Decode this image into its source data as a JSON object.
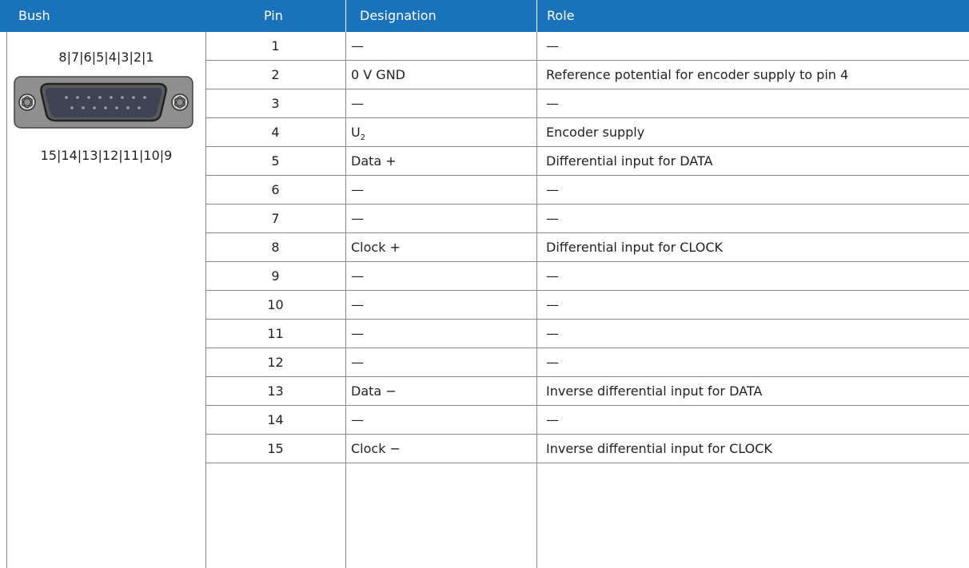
{
  "headers": {
    "bush": "Bush",
    "pin": "Pin",
    "designation": "Designation",
    "role": "Role"
  },
  "bush": {
    "top_pins": "8|7|6|5|4|3|2|1",
    "bottom_pins": "15|14|13|12|11|10|9",
    "connector_icon": "d-sub-15-pin-connector-icon"
  },
  "rows": [
    {
      "pin": "1",
      "designation": "—",
      "role": "—"
    },
    {
      "pin": "2",
      "designation": "0 V GND",
      "role": "Reference potential for encoder supply to pin 4"
    },
    {
      "pin": "3",
      "designation": "—",
      "role": "—"
    },
    {
      "pin": "4",
      "designation": "U",
      "designation_sub": "2",
      "role": "Encoder supply"
    },
    {
      "pin": "5",
      "designation": "Data +",
      "role": "Differential input for DATA"
    },
    {
      "pin": "6",
      "designation": "—",
      "role": "—"
    },
    {
      "pin": "7",
      "designation": "—",
      "role": "—"
    },
    {
      "pin": "8",
      "designation": "Clock +",
      "role": "Differential input for CLOCK"
    },
    {
      "pin": "9",
      "designation": "—",
      "role": "—"
    },
    {
      "pin": "10",
      "designation": "—",
      "role": "—"
    },
    {
      "pin": "11",
      "designation": "—",
      "role": "—"
    },
    {
      "pin": "12",
      "designation": "—",
      "role": "—"
    },
    {
      "pin": "13",
      "designation": "Data −",
      "role": "Inverse differential input for DATA"
    },
    {
      "pin": "14",
      "designation": "—",
      "role": "—"
    },
    {
      "pin": "15",
      "designation": "Clock −",
      "role": "Inverse differential input for CLOCK"
    }
  ],
  "colors": {
    "header_bg": "#1a72bb",
    "header_text": "#ffffff",
    "grid_line": "#8a8a8a"
  }
}
